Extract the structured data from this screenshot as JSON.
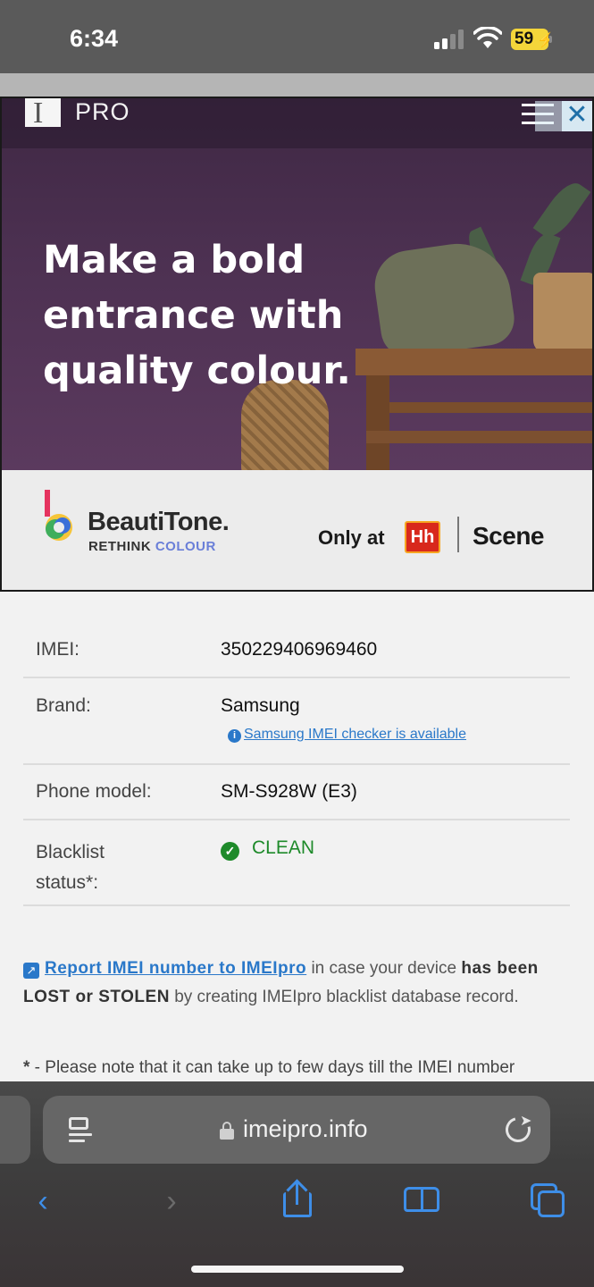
{
  "status_bar": {
    "time": "6:34",
    "battery": "59",
    "icons": [
      "signal-icon",
      "wifi-icon",
      "battery-charging-icon"
    ]
  },
  "ad": {
    "brand_mark": "I",
    "brand_text": "PRO",
    "headline": [
      "Make a bold",
      "entrance with",
      "quality colour."
    ],
    "advertiser_name": "BeautiTone.",
    "advertiser_tag_prefix": "RETHINK ",
    "advertiser_tag_accent": "COLOUR",
    "only_at": "Only at",
    "store_mark": "Hh",
    "partner": "Scene",
    "close_glyph": "✕"
  },
  "imei_info": {
    "rows": [
      {
        "label": "IMEI:",
        "value": "350229406969460"
      },
      {
        "label": "Brand:",
        "value": "Samsung",
        "link": "Samsung IMEI checker is available"
      },
      {
        "label": "Phone model:",
        "value": "SM-S928W (E3)"
      },
      {
        "label_line1": "Blacklist",
        "label_line2": "status*:",
        "value": "CLEAN",
        "status_color": "#1e8a2a"
      }
    ]
  },
  "report": {
    "link": "Report IMEI number to IMEIpro",
    "text1": " in case your device ",
    "bold1": "has been LOST or STOLEN",
    "text2": " by creating IMEIpro blacklist database record."
  },
  "note": {
    "asterisk": "*",
    "text": " - Please note that it can take up to few days till the IMEI number"
  },
  "browser": {
    "url": "imeipro.info",
    "accent_color": "#3e8ee8",
    "icons": [
      "reader-icon",
      "lock-icon",
      "reload-icon",
      "back-icon",
      "forward-icon",
      "share-icon",
      "bookmarks-icon",
      "tabs-icon"
    ]
  }
}
